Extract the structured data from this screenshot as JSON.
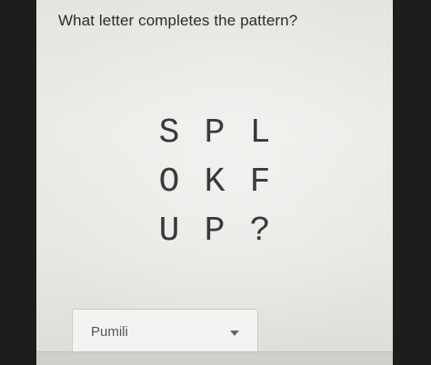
{
  "question": {
    "text": "What letter completes the pattern?"
  },
  "puzzle": {
    "rows": [
      [
        "S",
        "P",
        "L"
      ],
      [
        "O",
        "K",
        "F"
      ],
      [
        "U",
        "P",
        "?"
      ]
    ]
  },
  "answer_select": {
    "value": "Pumili",
    "caret_icon": "chevron-down-icon"
  }
}
